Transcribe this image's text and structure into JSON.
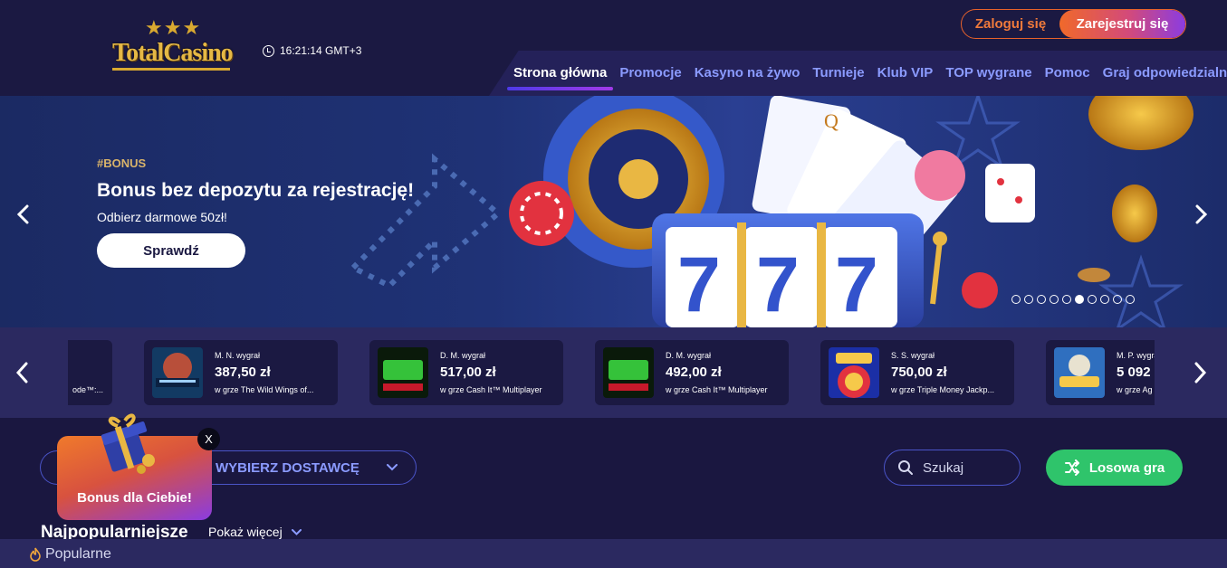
{
  "header": {
    "logo_text": "TotalCasino",
    "clock_time": "16:21:14 GMT+3",
    "login_label": "Zaloguj się",
    "register_label": "Zarejestruj się",
    "nav": [
      {
        "label": "Strona główna",
        "active": true
      },
      {
        "label": "Promocje",
        "active": false
      },
      {
        "label": "Kasyno na żywo",
        "active": false
      },
      {
        "label": "Turnieje",
        "active": false
      },
      {
        "label": "Klub VIP",
        "active": false
      },
      {
        "label": "TOP wygrane",
        "active": false
      },
      {
        "label": "Pomoc",
        "active": false
      },
      {
        "label": "Graj odpowiedzialnie",
        "active": false
      }
    ]
  },
  "hero": {
    "tag": "#BONUS",
    "title": "Bonus bez depozytu za rejestrację!",
    "subtitle": "Odbierz darmowe 50zł!",
    "cta_label": "Sprawdź",
    "slide_count": 10,
    "active_slide": 5
  },
  "winners": {
    "partial_left_game": "ode™:...",
    "cards": [
      {
        "name": "M. N. wygrał",
        "amount": "387,50 zł",
        "game": "w grze The Wild Wings of...",
        "thumb": "wild-wings-phoenix"
      },
      {
        "name": "D. M. wygrał",
        "amount": "517,00 zł",
        "game": "w grze Cash It™ Multiplayer",
        "thumb": "cash-it"
      },
      {
        "name": "D. M. wygrał",
        "amount": "492,00 zł",
        "game": "w grze Cash It™ Multiplayer",
        "thumb": "cash-it"
      },
      {
        "name": "S. S. wygrał",
        "amount": "750,00 zł",
        "game": "w grze Triple Money Jackp...",
        "thumb": "triple-money"
      },
      {
        "name": "M. P. wygrał",
        "amount": "5 092",
        "game": "w grze Ag",
        "thumb": "kings-olympus"
      }
    ]
  },
  "controls": {
    "provider_label": "WYBIERZ DOSTAWCĘ",
    "search_placeholder": "Szukaj",
    "random_label": "Losowa gra"
  },
  "section": {
    "title": "Najpopularniejsze",
    "show_more": "Pokaż więcej"
  },
  "bottom": {
    "label": "Popularne"
  },
  "bonus_popup": {
    "label": "Bonus dla Ciebie!",
    "close": "X"
  },
  "colors": {
    "bg": "#1a1740",
    "accent_blue": "#8b9bff",
    "gold": "#d9a930",
    "green": "#2fc46b",
    "orange": "#f0692a",
    "purple": "#8b3ce0"
  }
}
